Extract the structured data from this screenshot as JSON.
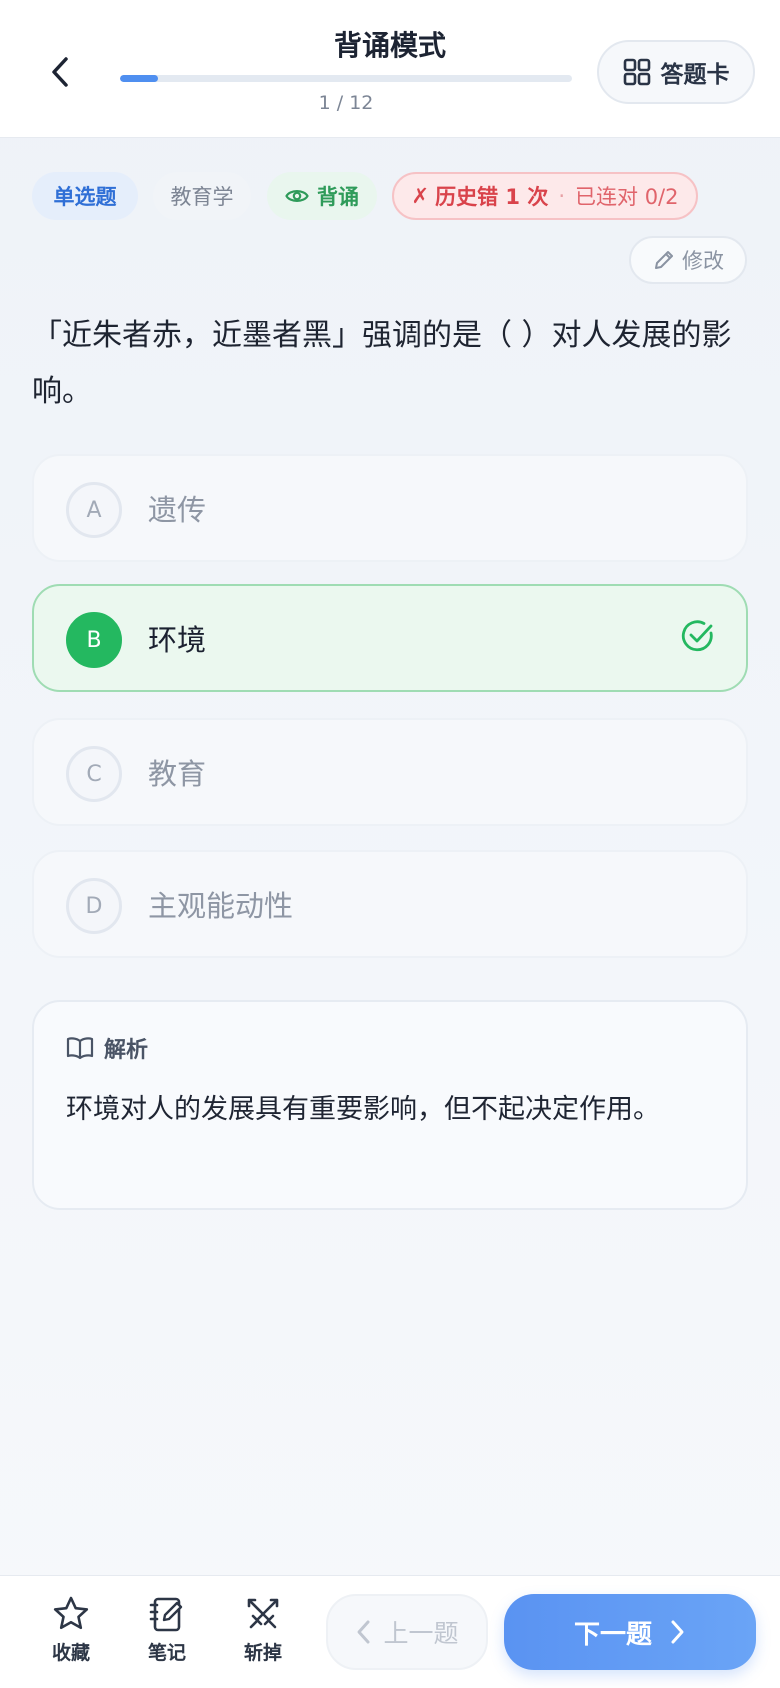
{
  "header": {
    "title": "背诵模式",
    "progress_text": "1 / 12",
    "progress_fraction": 0.083,
    "answer_card_label": "答题卡"
  },
  "tags": {
    "type": "单选题",
    "subject": "教育学",
    "mode": "背诵",
    "history_error": "历史错 1 次",
    "history_mark": "✗",
    "history_separator": "·",
    "streak": "已连对 0/2"
  },
  "edit_label": "修改",
  "question": "「近朱者赤，近墨者黑」强调的是（ ）对人发展的影响。",
  "options": [
    {
      "letter": "A",
      "text": "遗传"
    },
    {
      "letter": "B",
      "text": "环境"
    },
    {
      "letter": "C",
      "text": "教育"
    },
    {
      "letter": "D",
      "text": "主观能动性"
    }
  ],
  "correct_option": "B",
  "explanation": {
    "title": "解析",
    "body": "环境对人的发展具有重要影响，但不起决定作用。"
  },
  "bottom": {
    "favorite": "收藏",
    "note": "笔记",
    "cut": "斩掉",
    "prev": "上一题",
    "next": "下一题"
  },
  "colors": {
    "accent": "#4f8ff0",
    "correct": "#24b860",
    "error": "#d9434b"
  }
}
